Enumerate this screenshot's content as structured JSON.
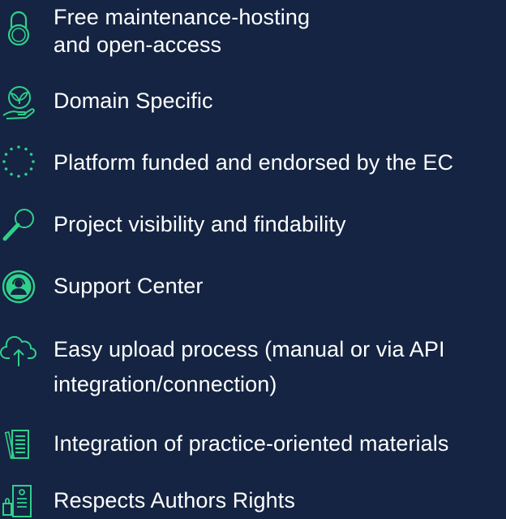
{
  "accent": "#2fd08a",
  "background": "#142442",
  "features": [
    {
      "icon": "padlock-icon",
      "lines": [
        "Free maintenance-hosting",
        "and open-access"
      ]
    },
    {
      "icon": "plant-in-hand-icon",
      "lines": [
        "Domain Specific"
      ]
    },
    {
      "icon": "stars-circle-icon",
      "lines": [
        "Platform funded and endorsed by the EC"
      ]
    },
    {
      "icon": "magnifier-icon",
      "lines": [
        "Project visibility and findability"
      ]
    },
    {
      "icon": "support-agent-icon",
      "lines": [
        "Support Center"
      ]
    },
    {
      "icon": "cloud-upload-icon",
      "lines": [
        "Easy upload process (manual or via API",
        "integration/connection)"
      ]
    },
    {
      "icon": "documents-icon",
      "lines": [
        "Integration of practice-oriented materials"
      ]
    },
    {
      "icon": "author-rights-icon",
      "lines": [
        "Respects Authors Rights"
      ]
    }
  ]
}
